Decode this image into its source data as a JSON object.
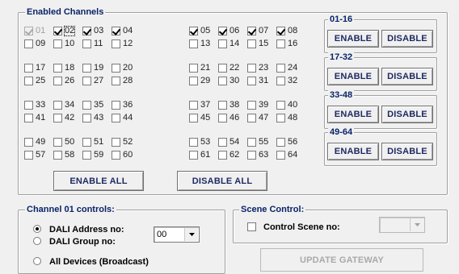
{
  "enabled_group": {
    "title": "Enabled Channels",
    "channels": [
      {
        "num": "01",
        "checked": true,
        "disabled": true,
        "focused": false
      },
      {
        "num": "02",
        "checked": true,
        "disabled": false,
        "focused": true
      },
      {
        "num": "03",
        "checked": true,
        "disabled": false,
        "focused": false
      },
      {
        "num": "04",
        "checked": true,
        "disabled": false,
        "focused": false
      },
      {
        "num": "05",
        "checked": true,
        "disabled": false,
        "focused": false
      },
      {
        "num": "06",
        "checked": true,
        "disabled": false,
        "focused": false
      },
      {
        "num": "07",
        "checked": true,
        "disabled": false,
        "focused": false
      },
      {
        "num": "08",
        "checked": true,
        "disabled": false,
        "focused": false
      },
      {
        "num": "09",
        "checked": false
      },
      {
        "num": "10",
        "checked": false
      },
      {
        "num": "11",
        "checked": false
      },
      {
        "num": "12",
        "checked": false
      },
      {
        "num": "13",
        "checked": false
      },
      {
        "num": "14",
        "checked": false
      },
      {
        "num": "15",
        "checked": false
      },
      {
        "num": "16",
        "checked": false
      },
      {
        "num": "17",
        "checked": false
      },
      {
        "num": "18",
        "checked": false
      },
      {
        "num": "19",
        "checked": false
      },
      {
        "num": "20",
        "checked": false
      },
      {
        "num": "21",
        "checked": false
      },
      {
        "num": "22",
        "checked": false
      },
      {
        "num": "23",
        "checked": false
      },
      {
        "num": "24",
        "checked": false
      },
      {
        "num": "25",
        "checked": false
      },
      {
        "num": "26",
        "checked": false
      },
      {
        "num": "27",
        "checked": false
      },
      {
        "num": "28",
        "checked": false
      },
      {
        "num": "29",
        "checked": false
      },
      {
        "num": "30",
        "checked": false
      },
      {
        "num": "31",
        "checked": false
      },
      {
        "num": "32",
        "checked": false
      },
      {
        "num": "33",
        "checked": false
      },
      {
        "num": "34",
        "checked": false
      },
      {
        "num": "35",
        "checked": false
      },
      {
        "num": "36",
        "checked": false
      },
      {
        "num": "37",
        "checked": false
      },
      {
        "num": "38",
        "checked": false
      },
      {
        "num": "39",
        "checked": false
      },
      {
        "num": "40",
        "checked": false
      },
      {
        "num": "41",
        "checked": false
      },
      {
        "num": "42",
        "checked": false
      },
      {
        "num": "43",
        "checked": false
      },
      {
        "num": "44",
        "checked": false
      },
      {
        "num": "45",
        "checked": false
      },
      {
        "num": "46",
        "checked": false
      },
      {
        "num": "47",
        "checked": false
      },
      {
        "num": "48",
        "checked": false
      },
      {
        "num": "49",
        "checked": false
      },
      {
        "num": "50",
        "checked": false
      },
      {
        "num": "51",
        "checked": false
      },
      {
        "num": "52",
        "checked": false
      },
      {
        "num": "53",
        "checked": false
      },
      {
        "num": "54",
        "checked": false
      },
      {
        "num": "55",
        "checked": false
      },
      {
        "num": "56",
        "checked": false
      },
      {
        "num": "57",
        "checked": false
      },
      {
        "num": "58",
        "checked": false
      },
      {
        "num": "59",
        "checked": false
      },
      {
        "num": "60",
        "checked": false
      },
      {
        "num": "61",
        "checked": false
      },
      {
        "num": "62",
        "checked": false
      },
      {
        "num": "63",
        "checked": false
      },
      {
        "num": "64",
        "checked": false
      }
    ],
    "enable_all_label": "ENABLE ALL",
    "disable_all_label": "DISABLE ALL",
    "range_groups": [
      {
        "title": "01-16",
        "enable_label": "ENABLE",
        "disable_label": "DISABLE"
      },
      {
        "title": "17-32",
        "enable_label": "ENABLE",
        "disable_label": "DISABLE"
      },
      {
        "title": "33-48",
        "enable_label": "ENABLE",
        "disable_label": "DISABLE"
      },
      {
        "title": "49-64",
        "enable_label": "ENABLE",
        "disable_label": "DISABLE"
      }
    ]
  },
  "channel_controls": {
    "title": "Channel 01 controls:",
    "dali_address_label": "DALI Address no:",
    "dali_address_selected": true,
    "dali_group_label": "DALI Group no:",
    "dali_group_selected": false,
    "address_value": "00",
    "all_devices_label": "All Devices (Broadcast)",
    "all_devices_selected": false
  },
  "scene_control": {
    "title": "Scene Control:",
    "control_scene_label": "Control Scene no:",
    "control_scene_checked": false,
    "scene_value": ""
  },
  "update_gateway_label": "UPDATE GATEWAY",
  "colors": {
    "background": "#f0f0f0",
    "group_title": "#0a246a",
    "button_text": "#1f2a63",
    "disabled_text": "#a9a9a9"
  }
}
